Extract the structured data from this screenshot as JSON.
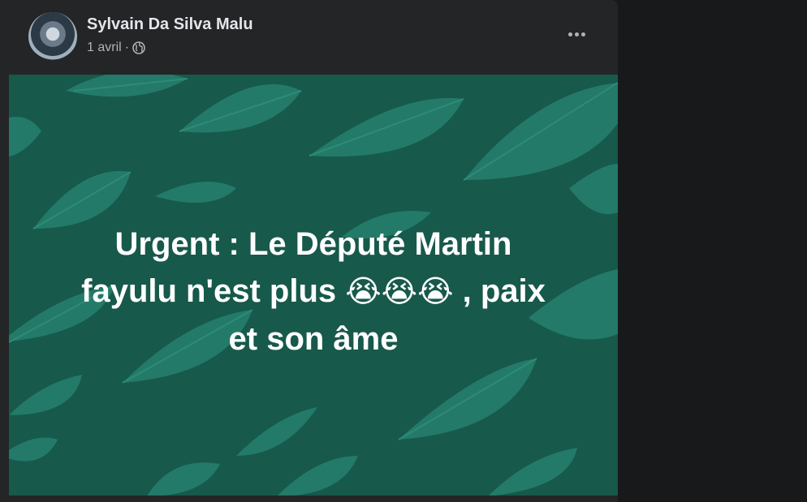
{
  "post": {
    "author": "Sylvain Da Silva Malu",
    "date": "1 avril",
    "separator": "·",
    "privacy_icon": "globe-icon",
    "more_icon": "more-options-icon",
    "message_line1": "Urgent : Le Député Martin",
    "message_line2_before": "fayulu n'est plus",
    "message_emojis": "😭😭😭",
    "message_line2_after": ", paix",
    "message_line3": "et son âme",
    "background_color": "#17594b",
    "leaf_color": "#237a68",
    "text_color": "#ffffff"
  }
}
